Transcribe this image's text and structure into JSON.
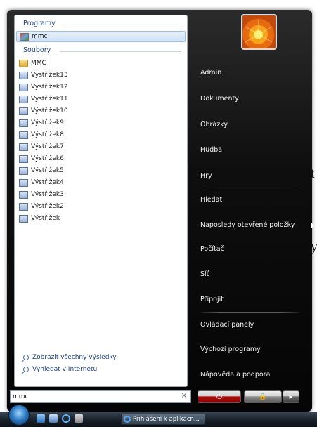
{
  "background": {
    "glyph1": "t",
    "glyph2": "y"
  },
  "left_pane": {
    "groups": [
      {
        "header": "Programy",
        "items": [
          {
            "label": "mmc",
            "icon": "mmc-icon",
            "selected": true
          }
        ]
      },
      {
        "header": "Soubory",
        "items": [
          {
            "label": "MMC",
            "icon": "folder-icon"
          },
          {
            "label": "Výstřižek13",
            "icon": "image-file-icon"
          },
          {
            "label": "Výstřižek12",
            "icon": "image-file-icon"
          },
          {
            "label": "Výstřižek11",
            "icon": "image-file-icon"
          },
          {
            "label": "Výstřižek10",
            "icon": "image-file-icon"
          },
          {
            "label": "Výstřižek9",
            "icon": "image-file-icon"
          },
          {
            "label": "Výstřižek8",
            "icon": "image-file-icon"
          },
          {
            "label": "Výstřižek7",
            "icon": "image-file-icon"
          },
          {
            "label": "Výstřižek6",
            "icon": "image-file-icon"
          },
          {
            "label": "Výstřižek5",
            "icon": "image-file-icon"
          },
          {
            "label": "Výstřižek4",
            "icon": "image-file-icon"
          },
          {
            "label": "Výstřižek3",
            "icon": "image-file-icon"
          },
          {
            "label": "Výstřižek2",
            "icon": "image-file-icon"
          },
          {
            "label": "Výstřižek",
            "icon": "image-file-icon"
          }
        ]
      }
    ],
    "links": {
      "show_all_results": "Zobrazit všechny výsledky",
      "search_internet": "Vyhledat v Internetu"
    }
  },
  "search": {
    "value": "mmc",
    "clear": "×"
  },
  "right_pane": {
    "items": [
      "Admin",
      "Dokumenty",
      "Obrázky",
      "Hudba",
      "Hry",
      "Hledat",
      "Naposledy otevřené položky",
      "Počítač",
      "Síť",
      "Připojit",
      "Ovládací panely",
      "Výchozí programy",
      "Nápověda a podpora"
    ]
  },
  "power": {
    "power_symbol": "⏻",
    "lock_symbol": "🔒",
    "more_symbol": "▸"
  },
  "taskbar": {
    "window_button": "Přihlášení k aplikacn..."
  },
  "colors": {
    "accent": "#1b3f8c",
    "menu_dark": "#0e0e0e",
    "selection": "#cfe2f6"
  }
}
